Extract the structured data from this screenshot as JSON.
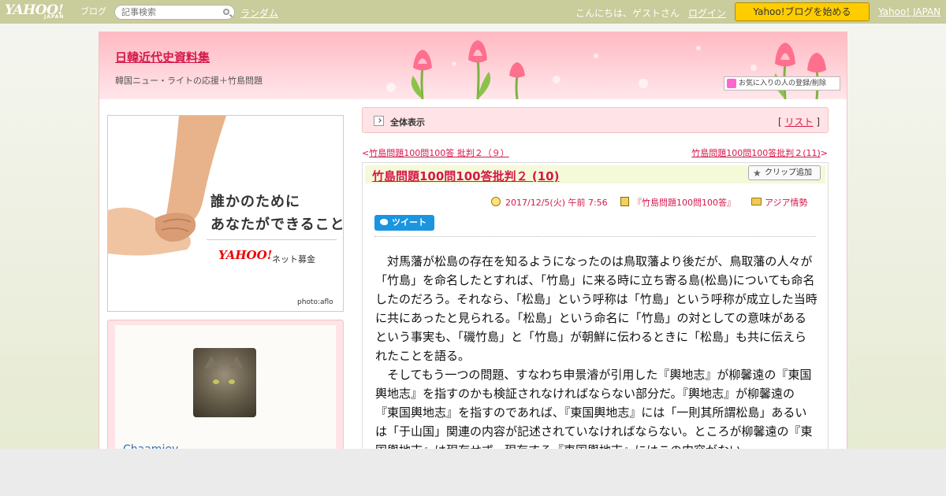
{
  "topbar": {
    "logo_main": "YAHOO!",
    "logo_sub": "JAPAN",
    "logo_blog": "ブログ",
    "search_placeholder": "記事検索",
    "random": "ランダム",
    "greeting": "こんにちは、ゲストさん",
    "login": "ログイン",
    "start_button": "Yahoo!ブログを始める",
    "yahoo_japan": "Yahoo! JAPAN"
  },
  "header": {
    "blog_title": "日韓近代史資料集",
    "blog_description": "韓国ニュー・ライトの応援＋竹島問題",
    "favorite_button": "お気に入りの人の登録/削除"
  },
  "ad": {
    "line1": "誰かのために",
    "line2": "あなたができること",
    "logo": "YAHOO!",
    "logo_sub": "ネット募金",
    "credit": "photo:aflo"
  },
  "profile": {
    "name": "Chaamiey"
  },
  "showall": {
    "label": "全体表示",
    "list_prefix": "[ ",
    "list_link": "リスト",
    "list_suffix": " ]"
  },
  "nav": {
    "prev_arrow": "<",
    "prev": "竹島問題100問100答 批判２（９）",
    "next": "竹島問題100問100答批判２(11)",
    "next_arrow": ">"
  },
  "article": {
    "title": "竹島問題100問100答批判２ (10)",
    "clip_button": "クリップ追加",
    "datetime": "2017/12/5(火) 午前 7:56",
    "category": "『竹島問題100問100答』",
    "folder": "アジア情勢",
    "tweet": "ツイート",
    "paragraphs": [
      "対馬藩が松島の存在を知るようになったのは鳥取藩より後だが、鳥取藩の人々が「竹島」を命名したとすれば、「竹島」に来る時に立ち寄る島(松島)についても命名したのだろう。それなら、「松島」という呼称は「竹島」という呼称が成立した当時に共にあったと見られる。「松島」という命名に「竹島」の対としての意味があるという事実も、「磯竹島」と「竹島」が朝鮮に伝わるときに「松島」も共に伝えられたことを語る。",
      "そしてもう一つの問題、すなわち申景濬が引用した『輿地志』が柳馨遠の『東国輿地志』を指すのかも検証されなければならない部分だ。『輿地志』が柳馨遠の『東国輿地志』を指すのであれば、『東国輿地志』には「一則其所謂松島」あるいは「于山国」関連の内容が記述されていなければならない。ところが柳馨遠の『東国輿地志』は現存せず、現存する『東国輿地志』にはこの内容がない。"
    ]
  }
}
